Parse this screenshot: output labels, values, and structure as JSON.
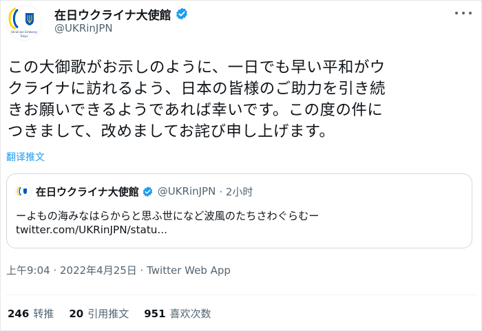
{
  "tweet": {
    "author": {
      "display_name": "在日ウクライナ大使館",
      "handle": "@UKRinJPN",
      "verified": true,
      "avatar_caption": [
        "Ukrainian Embassy",
        "Tokyo"
      ]
    },
    "text_lines": [
      "この大御歌がお示しのように、一日でも早い平和がウ",
      "クライナに訪れるよう、日本の皆様のご助力を引き続",
      "きお願いできるようであれば幸いです。この度の件に",
      "つきまして、改めましてお詫び申し上げます。"
    ],
    "translate_label": "翻译推文",
    "quoted": {
      "display_name": "在日ウクライナ大使館",
      "handle": "@UKRinJPN",
      "time": "· 2小时",
      "text": "ーよもの海みなはらからと思ふ世になど波風のたちさわぐらむー",
      "link": "twitter.com/UKRinJPN/statu..."
    },
    "meta": "上午9:04 · 2022年4月25日 · Twitter Web App",
    "stats": [
      {
        "count": "246",
        "label": "转推"
      },
      {
        "count": "20",
        "label": "引用推文"
      },
      {
        "count": "951",
        "label": "喜欢次数"
      }
    ]
  },
  "colors": {
    "accent": "#1d9bf0",
    "secondary_text": "#536471",
    "ukraine_blue": "#0057b8",
    "ukraine_yellow": "#ffd700"
  },
  "icons": {
    "verified": "verified-badge-icon",
    "more": "more-options-icon",
    "emblem": "ukraine-emblem-icon"
  }
}
